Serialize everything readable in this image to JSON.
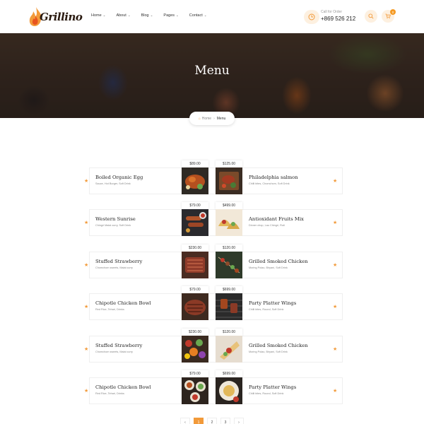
{
  "brand": {
    "name": "Grillino",
    "accent": "#f29a3a"
  },
  "nav": [
    {
      "label": "Home"
    },
    {
      "label": "About"
    },
    {
      "label": "Blog"
    },
    {
      "label": "Pages"
    },
    {
      "label": "Contact"
    }
  ],
  "order": {
    "label": "Call for Order",
    "phone": "+869 526 212"
  },
  "cart": {
    "count": "0"
  },
  "hero": {
    "title": "Menu"
  },
  "breadcrumb": {
    "home": "Home",
    "current": "Menu"
  },
  "menu": {
    "left": [
      {
        "name": "Boiled Organic Egg",
        "desc": "Sauce, Hot Burger, Soft Drink",
        "price": "$89.00",
        "photo": "grilled-chicken"
      },
      {
        "name": "Western Sunrise",
        "desc": "Chingri Malai curry, Soft Drink",
        "price": "$79.00",
        "photo": "sausages"
      },
      {
        "name": "Stuffed Strawberry",
        "desc": "Chomchom sweets, Malai curry",
        "price": "$230.00",
        "photo": "steak-slices"
      },
      {
        "name": "Chipotle Chicken Bowl",
        "desc": "Red Rice, Tehari, Drinks",
        "price": "$79.00",
        "photo": "steak"
      },
      {
        "name": "Stuffed Strawberry",
        "desc": "Chomchom sweets, Malai curry",
        "price": "$230.00",
        "photo": "vegetables"
      },
      {
        "name": "Chipotle Chicken Bowl",
        "desc": "Red Rice, Tehari, Drinks",
        "price": "$79.00",
        "photo": "table-spread"
      }
    ],
    "right": [
      {
        "name": "Philadelphia salmon",
        "desc": "Chilli bites, Chomchom, Soft Drink",
        "price": "$125.00",
        "photo": "meat-board"
      },
      {
        "name": "Antioxidant Fruits Mix",
        "desc": "Dinner chop, Lau Chingri, Ruti",
        "price": "$499.00",
        "photo": "tacos"
      },
      {
        "name": "Grilled Smoked Chicken",
        "desc": "Moring Polao, Biryani, Soft Drink",
        "price": "$120.00",
        "photo": "skewers"
      },
      {
        "name": "Party Platter Wings",
        "desc": "Chilli bites, Round, Soft Drink",
        "price": "$699.00",
        "photo": "grill"
      },
      {
        "name": "Grilled Smoked Chicken",
        "desc": "Moring Polao, Biryani, Soft Drink",
        "price": "$120.00",
        "photo": "burrito"
      },
      {
        "name": "Party Platter Wings",
        "desc": "Chilli bites, Round, Soft Drink",
        "price": "$699.00",
        "photo": "pasta-platter"
      }
    ]
  },
  "pagination": {
    "prev": "‹",
    "pages": [
      "1",
      "2",
      "3"
    ],
    "active_page": "1",
    "next": "›"
  }
}
